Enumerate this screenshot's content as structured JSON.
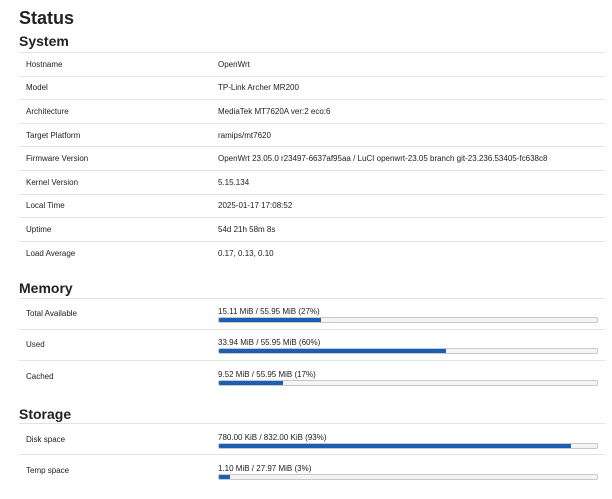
{
  "page": {
    "title": "Status"
  },
  "system": {
    "title": "System",
    "rows": [
      {
        "key": "Hostname",
        "value": "OpenWrt"
      },
      {
        "key": "Model",
        "value": "TP-Link Archer MR200"
      },
      {
        "key": "Architecture",
        "value": "MediaTek MT7620A ver:2 eco:6"
      },
      {
        "key": "Target Platform",
        "value": "ramips/mt7620"
      },
      {
        "key": "Firmware Version",
        "value": "OpenWrt 23.05.0 r23497-6637af95aa / LuCI openwrt-23.05 branch git-23.236.53405-fc638c8"
      },
      {
        "key": "Kernel Version",
        "value": "5.15.134"
      },
      {
        "key": "Local Time",
        "value": "2025-01-17 17:08:52"
      },
      {
        "key": "Uptime",
        "value": "54d 21h 58m 8s"
      },
      {
        "key": "Load Average",
        "value": "0.17, 0.13, 0.10"
      }
    ]
  },
  "memory": {
    "title": "Memory",
    "rows": [
      {
        "key": "Total Available",
        "value": "15.11 MiB / 55.95 MiB (27%)",
        "percent": 27
      },
      {
        "key": "Used",
        "value": "33.94 MiB / 55.95 MiB (60%)",
        "percent": 60
      },
      {
        "key": "Cached",
        "value": "9.52 MiB / 55.95 MiB (17%)",
        "percent": 17
      }
    ]
  },
  "storage": {
    "title": "Storage",
    "rows": [
      {
        "key": "Disk space",
        "value": "780.00 KiB / 832.00 KiB (93%)",
        "percent": 93
      },
      {
        "key": "Temp space",
        "value": "1.10 MiB / 27.97 MiB (3%)",
        "percent": 3
      }
    ]
  },
  "colors": {
    "bar_fill": "#1a5fb4",
    "bar_track": "#f4f4f4"
  }
}
